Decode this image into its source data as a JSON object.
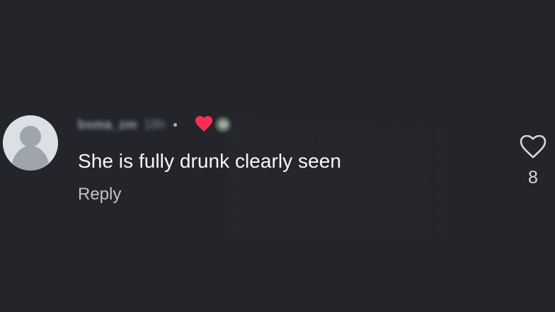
{
  "comment": {
    "username": "bsma_zm",
    "time": "18h",
    "separator": "•",
    "author_reaction_icon": "heart-filled-icon",
    "author_reaction_color": "#ff2d55",
    "text": "She is fully drunk clearly seen",
    "reply_label": "Reply",
    "like_icon": "heart-outline-icon",
    "like_count": "8"
  },
  "colors": {
    "background": "#23252b",
    "text": "#f7f7f8",
    "secondary_text": "#c2c4c8",
    "avatar_bg": "#dcdfe4"
  }
}
